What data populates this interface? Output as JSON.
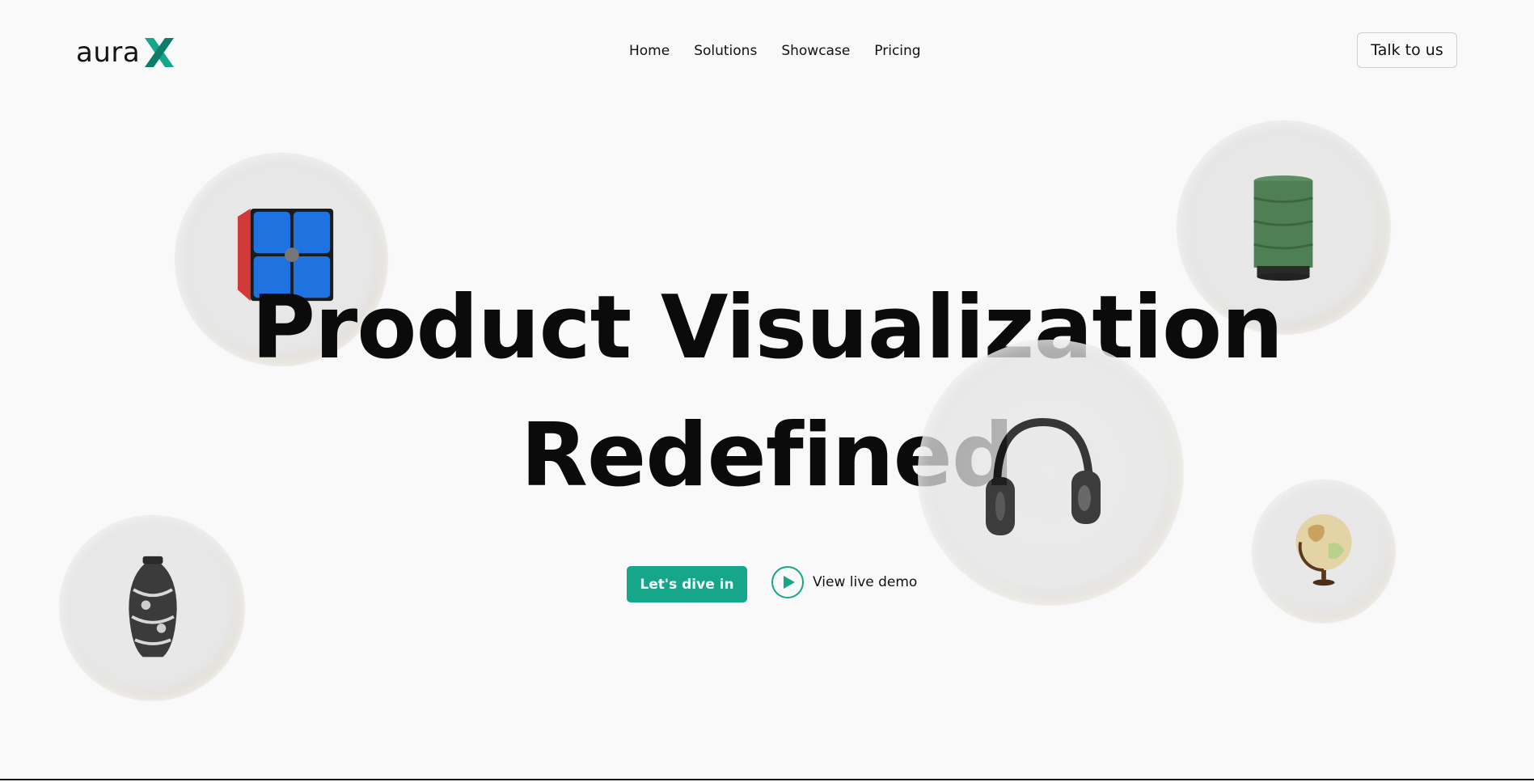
{
  "header": {
    "logo_text": "aura",
    "logo_mark": "X",
    "nav": [
      "Home",
      "Solutions",
      "Showcase",
      "Pricing"
    ],
    "cta_label": "Talk to us"
  },
  "hero": {
    "line1": "Product Visualization",
    "line2": "Redefined"
  },
  "actions": {
    "primary_label": "Let's dive in",
    "demo_label": "View live demo"
  },
  "colors": {
    "accent": "#16a689",
    "text": "#111111",
    "background": "#f9f9f9"
  },
  "icons": [
    "logo-x-mark",
    "play-icon",
    "rubiks-cube",
    "green-canister",
    "headphones",
    "vase",
    "globe"
  ]
}
